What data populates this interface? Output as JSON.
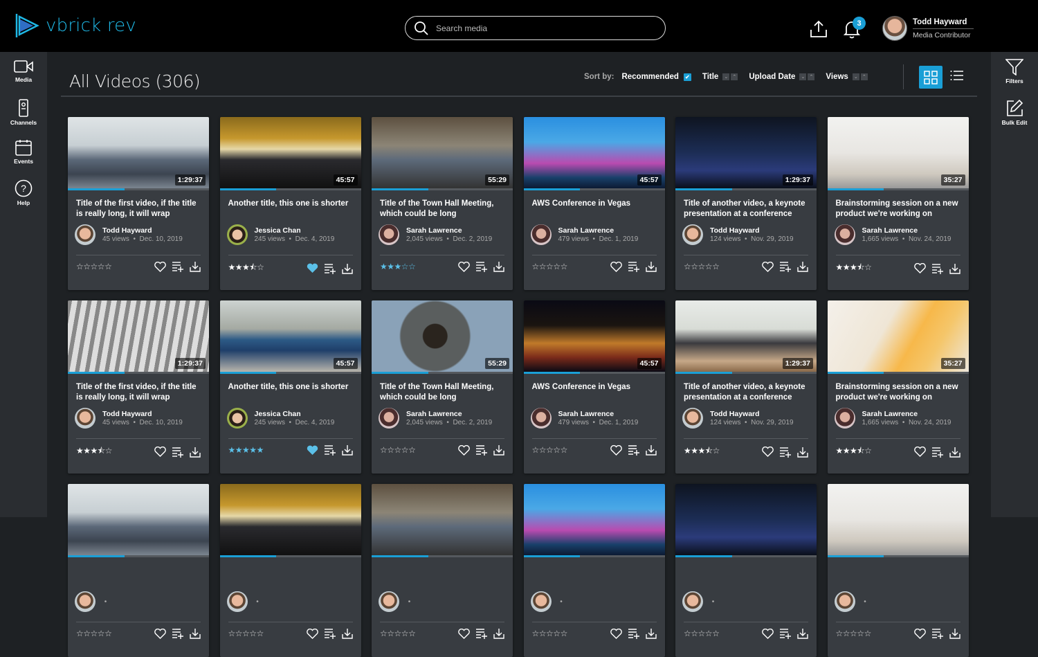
{
  "app": {
    "name": "vbrick rev",
    "accent": "#1a9fd6"
  },
  "header": {
    "search_placeholder": "Search media",
    "notifications_count": "3",
    "user": {
      "name": "Todd Hayward",
      "role": "Media Contributor"
    }
  },
  "leftnav": {
    "items": [
      {
        "label": "Media",
        "icon": "video-camera-icon"
      },
      {
        "label": "Channels",
        "icon": "remote-icon"
      },
      {
        "label": "Events",
        "icon": "calendar-icon"
      },
      {
        "label": "Help",
        "icon": "question-icon"
      }
    ]
  },
  "rightnav": {
    "items": [
      {
        "label": "Filters",
        "icon": "filter-icon"
      },
      {
        "label": "Bulk Edit",
        "icon": "edit-icon"
      }
    ]
  },
  "page": {
    "title": "All Videos (306)"
  },
  "sort": {
    "label": "Sort by:",
    "options": [
      "Recommended",
      "Title",
      "Upload Date",
      "Views"
    ],
    "selected": "Recommended"
  },
  "view": {
    "selected": "grid"
  },
  "videos": [
    {
      "title": "Title of the first video, if the title is really long, it will wrap",
      "duration": "1:29:37",
      "author": "Todd Hayward",
      "views": "45 views",
      "date": "Dec. 10, 2019",
      "rating": 0,
      "rated_by_user": false,
      "favorite": false,
      "progress": 0.4,
      "thumb": "office"
    },
    {
      "title": "Another title, this one is shorter",
      "duration": "45:57",
      "author": "Jessica Chan",
      "views": "245 views",
      "date": "Dec. 4, 2019",
      "rating": 3.5,
      "rated_by_user": false,
      "favorite": true,
      "progress": 0.4,
      "thumb": "auditorium"
    },
    {
      "title": "Title of the Town Hall Meeting, which could be long",
      "duration": "55:29",
      "author": "Sarah Lawrence",
      "views": "2,045 views",
      "date": "Dec. 2, 2019",
      "rating": 3,
      "rated_by_user": true,
      "favorite": false,
      "progress": 0.4,
      "thumb": "microphone"
    },
    {
      "title": "AWS Conference in Vegas",
      "duration": "45:57",
      "author": "Sarah Lawrence",
      "views": "479 views",
      "date": "Dec. 1, 2019",
      "rating": 0,
      "rated_by_user": false,
      "favorite": false,
      "progress": 0.4,
      "thumb": "vegas"
    },
    {
      "title": "Title of another video, a keynote presentation at a conference",
      "duration": "1:29:37",
      "author": "Todd Hayward",
      "views": "124 views",
      "date": "Nov. 29, 2019",
      "rating": 0,
      "rated_by_user": false,
      "favorite": false,
      "progress": 0.4,
      "thumb": "conference"
    },
    {
      "title": "Brainstorming session on a new product we're working on",
      "duration": "35:27",
      "author": "Sarah Lawrence",
      "views": "1,665 views",
      "date": "Nov. 24, 2019",
      "rating": 3.5,
      "rated_by_user": false,
      "favorite": false,
      "progress": 0.4,
      "thumb": "whiteboard"
    },
    {
      "title": "Title of the first video, if the title is really long, it will wrap",
      "duration": "1:29:37",
      "author": "Todd Hayward",
      "views": "45 views",
      "date": "Dec. 10, 2019",
      "rating": 3.5,
      "rated_by_user": false,
      "favorite": false,
      "progress": 0.4,
      "thumb": "crosswalk"
    },
    {
      "title": "Another title, this one is shorter",
      "duration": "45:57",
      "author": "Jessica Chan",
      "views": "245 views",
      "date": "Dec. 4, 2019",
      "rating": 5,
      "rated_by_user": true,
      "favorite": true,
      "progress": 0.4,
      "thumb": "laptop"
    },
    {
      "title": "Title of the Town Hall Meeting, which could be long",
      "duration": "55:29",
      "author": "Sarah Lawrence",
      "views": "2,045 views",
      "date": "Dec. 2, 2019",
      "rating": 0,
      "rated_by_user": false,
      "favorite": false,
      "progress": 0.4,
      "thumb": "coffee"
    },
    {
      "title": "AWS Conference in Vegas",
      "duration": "45:57",
      "author": "Sarah Lawrence",
      "views": "479 views",
      "date": "Dec. 1, 2019",
      "rating": 0,
      "rated_by_user": false,
      "favorite": false,
      "progress": 0.4,
      "thumb": "vegas-night"
    },
    {
      "title": "Title of another video, a keynote presentation at a conference",
      "duration": "1:29:37",
      "author": "Todd Hayward",
      "views": "124 views",
      "date": "Nov. 29, 2019",
      "rating": 3.5,
      "rated_by_user": false,
      "favorite": false,
      "progress": 0.4,
      "thumb": "woman-office"
    },
    {
      "title": "Brainstorming session on a new product we're working on",
      "duration": "35:27",
      "author": "Sarah Lawrence",
      "views": "1,665 views",
      "date": "Nov. 24, 2019",
      "rating": 3.5,
      "rated_by_user": false,
      "favorite": false,
      "progress": 0.4,
      "thumb": "sticky-notes"
    },
    {
      "title": "",
      "duration": "",
      "author": "",
      "views": "",
      "date": "",
      "rating": 0,
      "thumb": "office"
    },
    {
      "title": "",
      "duration": "",
      "author": "",
      "views": "",
      "date": "",
      "rating": 0,
      "thumb": "auditorium"
    },
    {
      "title": "",
      "duration": "",
      "author": "",
      "views": "",
      "date": "",
      "rating": 0,
      "thumb": "microphone"
    },
    {
      "title": "",
      "duration": "",
      "author": "",
      "views": "",
      "date": "",
      "rating": 0,
      "thumb": "vegas"
    },
    {
      "title": "",
      "duration": "",
      "author": "",
      "views": "",
      "date": "",
      "rating": 0,
      "thumb": "conference"
    },
    {
      "title": "",
      "duration": "",
      "author": "",
      "views": "",
      "date": "",
      "rating": 0,
      "thumb": "whiteboard"
    }
  ]
}
